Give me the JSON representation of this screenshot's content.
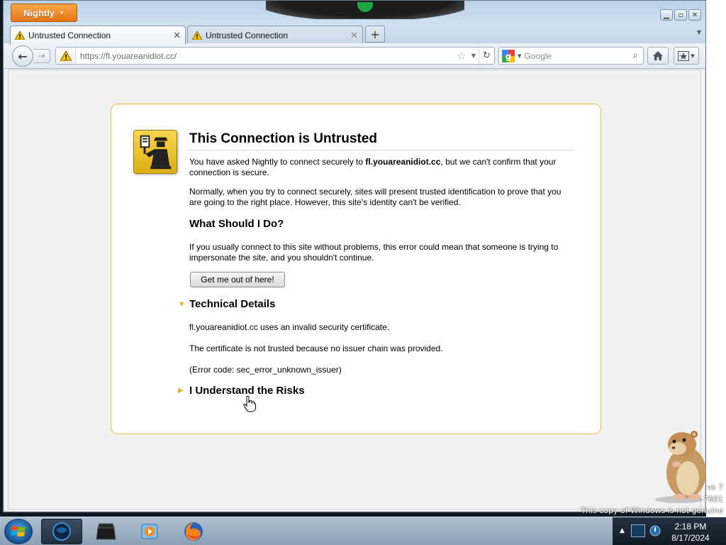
{
  "browser": {
    "app_menu_label": "Nightly",
    "tabs": [
      {
        "label": "Untrusted Connection",
        "active": true
      },
      {
        "label": "Untrusted Connection",
        "active": false
      }
    ],
    "url": "https://fl.youareanidiot.cc/",
    "search_placeholder": "Google",
    "colors": {
      "app_menu": "#e67613",
      "error_border": "#f0bd45",
      "expander_arrow": "#e8b41b"
    }
  },
  "error_page": {
    "title": "This Connection is Untrusted",
    "intro_prefix": "You have asked Nightly to connect securely to ",
    "intro_host": "fl.youareanidiot.cc",
    "intro_suffix": ", but we can't confirm that your connection is secure.",
    "normally_text": "Normally, when you try to connect securely, sites will present trusted identification to prove that you are going to the right place. However, this site's identity can't be verified.",
    "what_heading": "What Should I Do?",
    "what_text": "If you usually connect to this site without problems, this error could mean that someone is trying to impersonate the site, and you shouldn't continue.",
    "get_out_label": "Get me out of here!",
    "tech_heading": "Technical Details",
    "tech_line1": "fl.youareanidiot.cc uses an invalid security certificate.",
    "tech_line2": "The certificate is not trusted because no issuer chain was provided.",
    "tech_line3": "(Error code: sec_error_unknown_issuer)",
    "risks_heading": "I Understand the Risks",
    "icons": {
      "certificate": "certificate-officer-icon",
      "tech_expander": "triangle-down-icon",
      "risk_expander": "triangle-right-icon"
    }
  },
  "desktop": {
    "watermark_line1": "vs 7",
    "watermark_line2": "7601",
    "watermark_line3": "This copy of Windows is not genuine"
  },
  "taskbar": {
    "time": "2:18 PM",
    "date": "8/17/2024"
  }
}
